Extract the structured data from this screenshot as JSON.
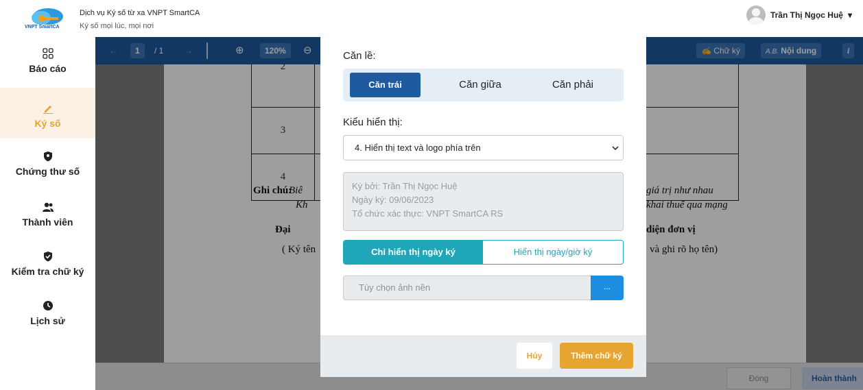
{
  "header": {
    "logo_text": "VNPT SmartCA",
    "title": "Dịch vụ Ký số từ xa VNPT SmartCA",
    "subtitle": "Ký số mọi lúc, mọi nơi",
    "user_name": "Trần Thị Ngọc Huệ",
    "user_caret": "▾"
  },
  "sidebar": {
    "items": [
      {
        "label": "Báo cáo",
        "icon": "grid-icon"
      },
      {
        "label": "Ký số",
        "icon": "pen-icon"
      },
      {
        "label": "Chứng thư số",
        "icon": "shield-icon"
      },
      {
        "label": "Thành viên",
        "icon": "users-icon"
      },
      {
        "label": "Kiểm tra chữ ký",
        "icon": "shield-check-icon"
      },
      {
        "label": "Lịch sử",
        "icon": "clock-icon"
      }
    ],
    "active_index": 1
  },
  "toolbar": {
    "prev": "←",
    "page": "1",
    "total": "/ 1",
    "next": "→",
    "zoom_in": "⊕",
    "zoom": "120%",
    "zoom_out": "⊖",
    "signature": "Chữ ký",
    "content": "Nội dung",
    "content_prefix": "A.B.",
    "info": "i"
  },
  "document": {
    "rows": [
      "2",
      "3",
      "4"
    ],
    "note_label": "Ghi chú:",
    "note_frag1": "Biê",
    "note_frag2": "Kh",
    "note_right1": "giá trị như nhau",
    "note_right2": "khai thuế qua mạng",
    "rep_left": "Đại",
    "rep_right": "diện đơn vị",
    "sign_left": "( Ký tên",
    "sign_right": "và ghi rõ họ tên)"
  },
  "footer": {
    "close": "Đóng",
    "finish": "Hoàn thành"
  },
  "modal": {
    "align_label": "Căn lề:",
    "align_options": [
      "Căn trái",
      "Căn giữa",
      "Căn phải"
    ],
    "align_selected": 0,
    "display_label": "Kiểu hiển thị:",
    "display_value": "4. Hiển thị text và logo phía trên",
    "preview_lines": [
      "Ký bởi: Trần Thị Ngọc Huệ",
      "Ngày ký: 09/06/2023",
      "Tổ chức xác thực: VNPT SmartCA RS"
    ],
    "date_options": [
      "Chỉ hiển thị ngày ký",
      "Hiển thị ngày/giờ ký"
    ],
    "date_selected": 0,
    "background_placeholder": "Tùy chọn ảnh nền",
    "background_button": "...",
    "cancel": "Hủy",
    "add": "Thêm chữ ký"
  },
  "colors": {
    "brand_blue": "#1e5aa0",
    "accent_orange": "#e6a431",
    "teal": "#1fa6b8"
  }
}
